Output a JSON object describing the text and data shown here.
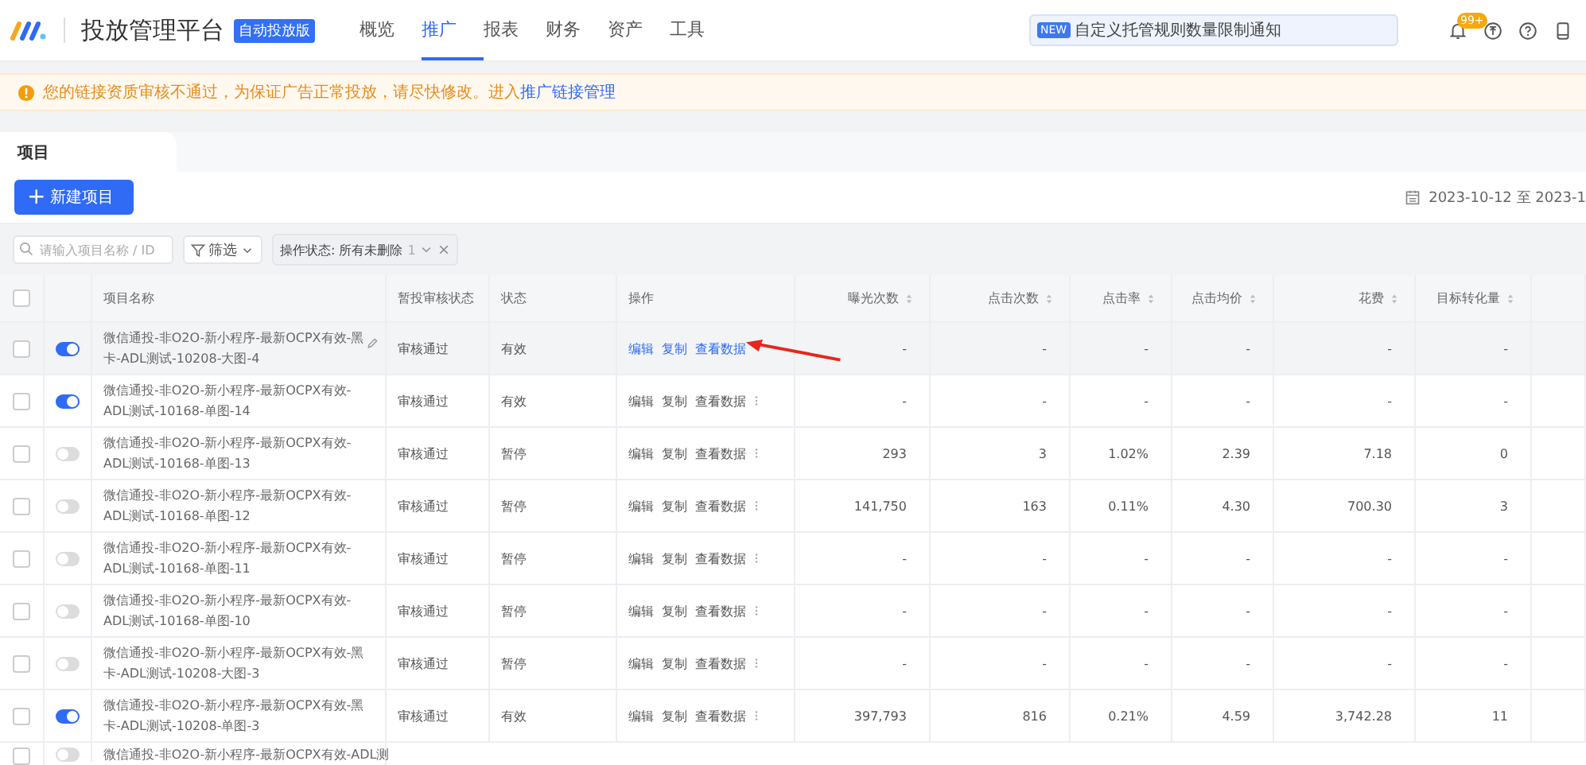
{
  "header": {
    "title": "投放管理平台",
    "badge": "自动投放版",
    "nav": [
      {
        "label": "概览",
        "selected": false
      },
      {
        "label": "推广",
        "selected": true
      },
      {
        "label": "报表",
        "selected": false
      },
      {
        "label": "财务",
        "selected": false
      },
      {
        "label": "资产",
        "selected": false
      },
      {
        "label": "工具",
        "selected": false
      }
    ],
    "notice": {
      "tag": "NEW",
      "text": "自定义托管规则数量限制通知"
    },
    "bell_count": "99+"
  },
  "warning": {
    "text": "您的链接资质审核不通过，为保证广告正常投放，请尽快修改。进入",
    "link": "推广链接管理"
  },
  "tabs": [
    {
      "label": "项目"
    }
  ],
  "new_button": {
    "icon": "+",
    "label": "新建项目"
  },
  "date_range": "2023-10-12 至 2023-1",
  "filters": {
    "search_placeholder": "请输入项目名称 / ID",
    "filter_label": "筛选",
    "chip": "操作状态: 所有未删除",
    "chip_count": "1"
  },
  "table": {
    "select_all_checked": false,
    "columns": [
      "项目名称",
      "暂投审核状态",
      "状态",
      "操作",
      "曝光次数",
      "点击次数",
      "点击率",
      "点击均价",
      "花费",
      "目标转化量"
    ],
    "rows": [
      {
        "checked": false,
        "on": true,
        "hovered": true,
        "name": "微信通投-非O2O-新小程序-最新OCPX有效-黑卡-ADL测试-10208-大图-4",
        "review": "审核通过",
        "status": "有效",
        "actions": [
          "编辑",
          "复制",
          "查看数据"
        ],
        "values": [
          "-",
          "-",
          "-",
          "-",
          "-",
          "-"
        ]
      },
      {
        "checked": false,
        "on": true,
        "hovered": false,
        "name": "微信通投-非O2O-新小程序-最新OCPX有效-ADL测试-10168-单图-14",
        "review": "审核通过",
        "status": "有效",
        "actions": [
          "编辑",
          "复制",
          "查看数据"
        ],
        "values": [
          "-",
          "-",
          "-",
          "-",
          "-",
          "-"
        ]
      },
      {
        "checked": false,
        "on": false,
        "hovered": false,
        "name": "微信通投-非O2O-新小程序-最新OCPX有效-ADL测试-10168-单图-13",
        "review": "审核通过",
        "status": "暂停",
        "actions": [
          "编辑",
          "复制",
          "查看数据"
        ],
        "values": [
          "293",
          "3",
          "1.02%",
          "2.39",
          "7.18",
          "0"
        ]
      },
      {
        "checked": false,
        "on": false,
        "hovered": false,
        "name": "微信通投-非O2O-新小程序-最新OCPX有效-ADL测试-10168-单图-12",
        "review": "审核通过",
        "status": "暂停",
        "actions": [
          "编辑",
          "复制",
          "查看数据"
        ],
        "values": [
          "141,750",
          "163",
          "0.11%",
          "4.30",
          "700.30",
          "3"
        ]
      },
      {
        "checked": false,
        "on": false,
        "hovered": false,
        "name": "微信通投-非O2O-新小程序-最新OCPX有效-ADL测试-10168-单图-11",
        "review": "审核通过",
        "status": "暂停",
        "actions": [
          "编辑",
          "复制",
          "查看数据"
        ],
        "values": [
          "-",
          "-",
          "-",
          "-",
          "-",
          "-"
        ]
      },
      {
        "checked": false,
        "on": false,
        "hovered": false,
        "name": "微信通投-非O2O-新小程序-最新OCPX有效-ADL测试-10168-单图-10",
        "review": "审核通过",
        "status": "暂停",
        "actions": [
          "编辑",
          "复制",
          "查看数据"
        ],
        "values": [
          "-",
          "-",
          "-",
          "-",
          "-",
          "-"
        ]
      },
      {
        "checked": false,
        "on": false,
        "hovered": false,
        "name": "微信通投-非O2O-新小程序-最新OCPX有效-黑卡-ADL测试-10208-大图-3",
        "review": "审核通过",
        "status": "暂停",
        "actions": [
          "编辑",
          "复制",
          "查看数据"
        ],
        "values": [
          "-",
          "-",
          "-",
          "-",
          "-",
          "-"
        ]
      },
      {
        "checked": false,
        "on": true,
        "hovered": false,
        "name": "微信通投-非O2O-新小程序-最新OCPX有效-黑卡-ADL测试-10208-单图-3",
        "review": "审核通过",
        "status": "有效",
        "actions": [
          "编辑",
          "复制",
          "查看数据"
        ],
        "values": [
          "397,793",
          "816",
          "0.21%",
          "4.59",
          "3,742.28",
          "11"
        ]
      }
    ],
    "partial_row": {
      "checked": false,
      "on": false,
      "name": "微信通投-非O2O-新小程序-最新OCPX有效-ADL测"
    }
  }
}
